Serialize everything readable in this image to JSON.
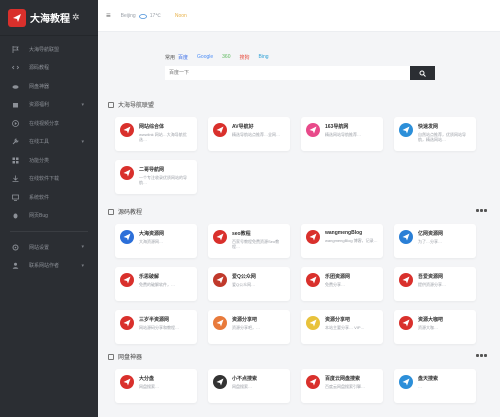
{
  "brand": {
    "name": "大海教程",
    "sparkle": "✲"
  },
  "sidebar": {
    "items": [
      {
        "label": "大海导航联盟",
        "icon": "flag-icon"
      },
      {
        "label": "源码教程",
        "icon": "code-icon"
      },
      {
        "label": "网盘神器",
        "icon": "cloud-icon"
      },
      {
        "label": "资源福利",
        "icon": "gift-icon",
        "arrow": "▾"
      },
      {
        "label": "在线视频分享",
        "icon": "play-icon"
      },
      {
        "label": "在线工具",
        "icon": "tool-icon",
        "arrow": "▾"
      },
      {
        "label": "功能分类",
        "icon": "grid-icon"
      },
      {
        "label": "在线软件下载",
        "icon": "download-icon"
      },
      {
        "label": "系统软件",
        "icon": "monitor-icon"
      },
      {
        "label": "网页Bug",
        "icon": "bug-icon"
      }
    ],
    "bottom_items": [
      {
        "label": "网站设置",
        "icon": "gear-icon",
        "arrow": "▾"
      },
      {
        "label": "联系网站作者",
        "icon": "user-icon",
        "arrow": "▾"
      }
    ]
  },
  "topbar": {
    "menu_icon": "≡",
    "city": "Beijing",
    "temp": "17℃",
    "label": "Noon"
  },
  "search": {
    "label": "常用",
    "tabs": [
      {
        "label": "百度",
        "color": "#3b6ee8"
      },
      {
        "label": "Google",
        "color": "#4d8ef7"
      },
      {
        "label": "360",
        "color": "#5cb85c"
      },
      {
        "label": "搜狗",
        "color": "#e84a3b"
      },
      {
        "label": "Bing",
        "color": "#2a9fd6"
      }
    ],
    "placeholder": "百度一下"
  },
  "sections": [
    {
      "title": "大海导航联盟",
      "cards": [
        {
          "title": "网站综合体",
          "desc": "wwwlink 网站…大海导航优选…",
          "icon_color": "#d9302c"
        },
        {
          "title": "AV导航好",
          "desc": "精选导航站点推荐…全网…",
          "icon_color": "#d9302c"
        },
        {
          "title": "163导航网",
          "desc": "精选网站导航推荐…",
          "icon_color": "#e84a8a"
        },
        {
          "title": "快速发网",
          "desc": "自然站点推荐，优质网站导航，精选网站…",
          "icon_color": "#2c8fd9"
        },
        {
          "title": "二哥导航网",
          "desc": "一个专注收录优质网站的导航…",
          "icon_color": "#d9302c"
        }
      ]
    },
    {
      "title": "源码教程",
      "cards": [
        {
          "title": "大海资源网",
          "desc": "大海资源网…",
          "icon_color": "#2c6fd9"
        },
        {
          "title": "seo教程",
          "desc": "百家号教程免费资源Seo教程…",
          "icon_color": "#d9302c"
        },
        {
          "title": "wangmengBlog",
          "desc": "wangmengBlog 博客，记录…",
          "icon_color": "#d9302c"
        },
        {
          "title": "亿网资源网",
          "desc": "为了…分享…",
          "icon_color": "#2a7fd6"
        },
        {
          "title": "乐思破解",
          "desc": "免费的破解软件，…",
          "icon_color": "#d9302c"
        },
        {
          "title": "爱Q公众网",
          "desc": "爱Q公众网…",
          "icon_color": "#c0392b"
        },
        {
          "title": "乐团资源网",
          "desc": "免费分享…",
          "icon_color": "#d9302c"
        },
        {
          "title": "吾爱资源网",
          "desc": "提供资源分享…",
          "icon_color": "#d9302c"
        },
        {
          "title": "三岁半资源网",
          "desc": "网站源码分享和教程…",
          "icon_color": "#d9302c"
        },
        {
          "title": "资源分享吧",
          "desc": "资源分享吧，…",
          "icon_color": "#e87a3b"
        },
        {
          "title": "资源分享吧",
          "desc": "本站主要分享… VIP…",
          "icon_color": "#e8c23b"
        },
        {
          "title": "资源大咖吧",
          "desc": "资源大咖…",
          "icon_color": "#d9302c"
        }
      ]
    },
    {
      "title": "网盘神器",
      "cards": [
        {
          "title": "大分盘",
          "desc": "网盘搜索…",
          "icon_color": "#d9302c"
        },
        {
          "title": "小不点搜索",
          "desc": "网盘搜索…",
          "icon_color": "#333333"
        },
        {
          "title": "百度云网盘搜索",
          "desc": "百度云网盘搜索引擎…",
          "icon_color": "#d9302c"
        },
        {
          "title": "盘天搜索",
          "desc": "…",
          "icon_color": "#2c8fd9"
        }
      ]
    }
  ]
}
